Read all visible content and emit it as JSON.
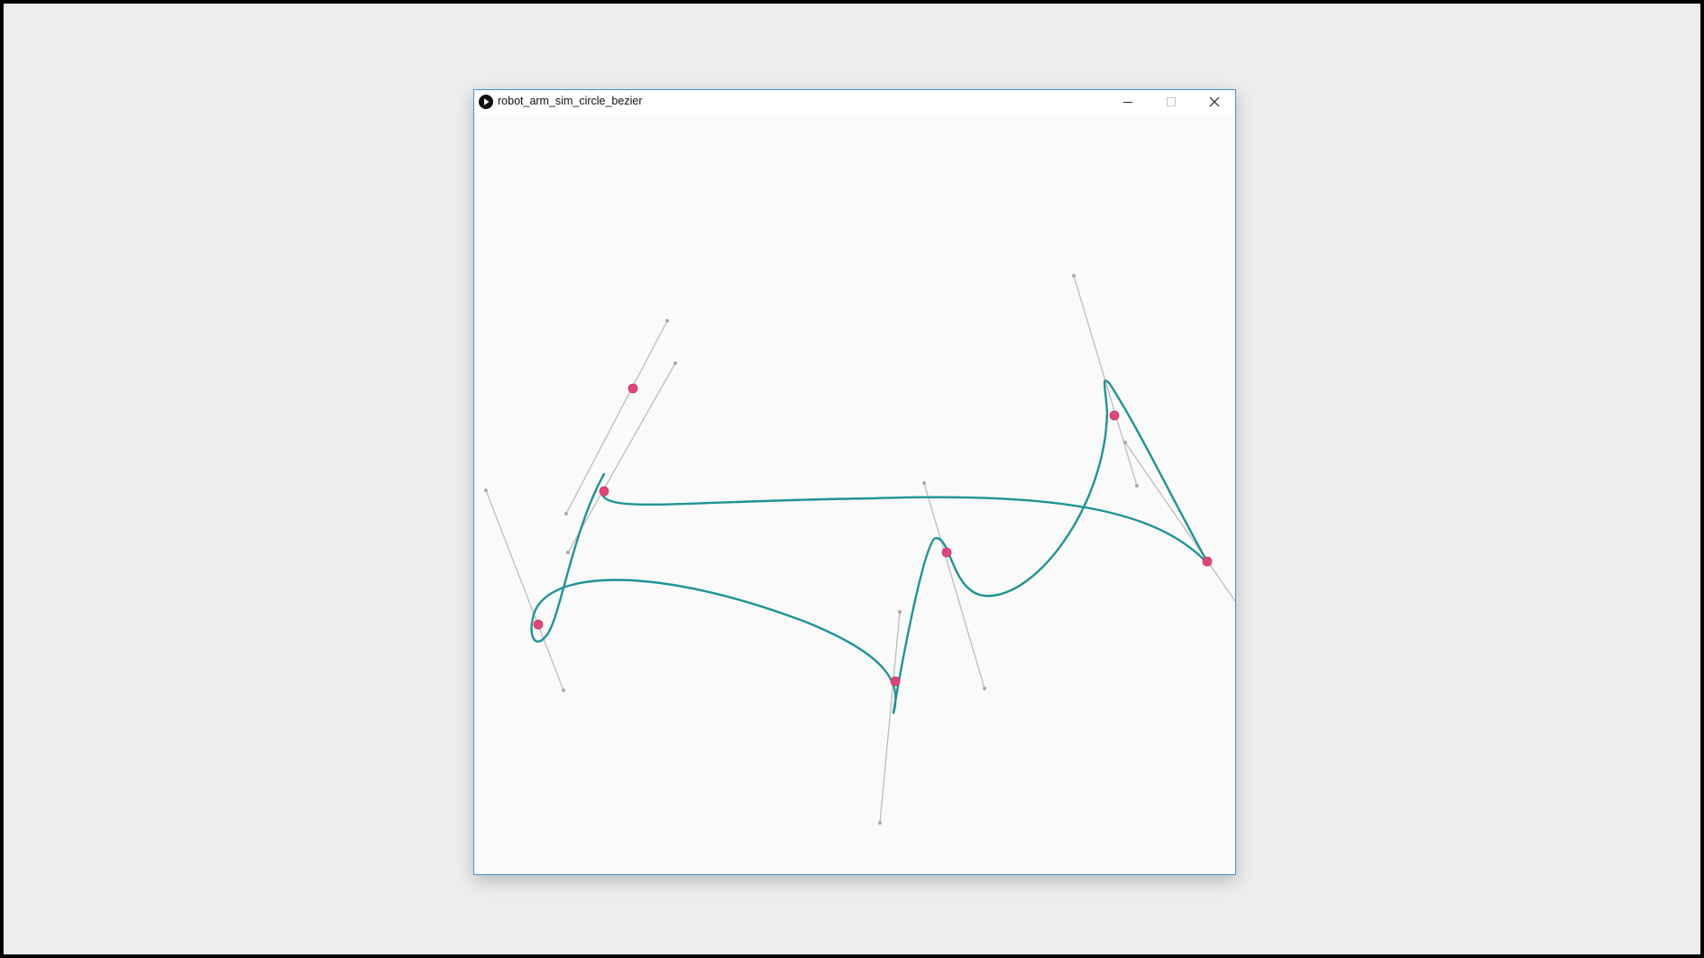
{
  "window": {
    "title": "robot_arm_sim_circle_bezier",
    "controls": {
      "minimize": "minimize",
      "maximize": "maximize",
      "close": "close"
    }
  },
  "icons": {
    "app": "play-circle-icon",
    "minimize": "minimize-icon",
    "maximize": "maximize-icon",
    "close": "close-icon"
  },
  "colors": {
    "curve": "#1f9495",
    "anchor": "#e0457b",
    "handle": "#bdbdbd",
    "handle_dot": "#a9a9a9",
    "canvas_bg": "#fafafa",
    "desktop_bg": "#ededed",
    "window_border": "#3c93d6"
  }
}
